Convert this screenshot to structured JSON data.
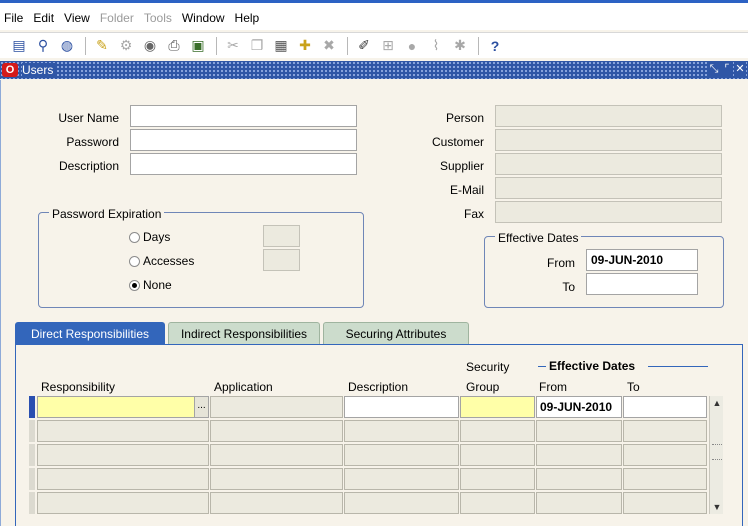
{
  "menu": [
    "File",
    "Edit",
    "View",
    "Folder",
    "Tools",
    "Window",
    "Help"
  ],
  "menu_disabled": [
    "Folder",
    "Tools"
  ],
  "window": {
    "title": "Users"
  },
  "user_form": {
    "user_name_label": "User Name",
    "password_label": "Password",
    "description_label": "Description",
    "person_label": "Person",
    "customer_label": "Customer",
    "supplier_label": "Supplier",
    "email_label": "E-Mail",
    "fax_label": "Fax"
  },
  "password_expiration": {
    "title": "Password Expiration",
    "days_label": "Days",
    "accesses_label": "Accesses",
    "none_label": "None",
    "selected": "None"
  },
  "effective_dates": {
    "title": "Effective Dates",
    "from_label": "From",
    "to_label": "To",
    "from_value": "09-JUN-2010",
    "to_value": ""
  },
  "tabs": [
    "Direct Responsibilities",
    "Indirect Responsibilities",
    "Securing Attributes"
  ],
  "responsibilities": {
    "effective_dates_header": "Effective Dates",
    "columns": {
      "responsibility": "Responsibility",
      "application": "Application",
      "description": "Description",
      "security_group_line1": "Security",
      "security_group_line2": "Group",
      "from": "From",
      "to": "To"
    },
    "rows": [
      {
        "responsibility": "",
        "application": "",
        "description": "",
        "security_group": "",
        "from": "09-JUN-2010",
        "to": ""
      },
      {
        "responsibility": "",
        "application": "",
        "description": "",
        "security_group": "",
        "from": "",
        "to": ""
      },
      {
        "responsibility": "",
        "application": "",
        "description": "",
        "security_group": "",
        "from": "",
        "to": ""
      },
      {
        "responsibility": "",
        "application": "",
        "description": "",
        "security_group": "",
        "from": "",
        "to": ""
      },
      {
        "responsibility": "",
        "application": "",
        "description": "",
        "security_group": "",
        "from": "",
        "to": ""
      }
    ],
    "lov_button": "..."
  },
  "colors": {
    "title_bar": "#2f56a6",
    "active_tab": "#3366bb",
    "inactive_tab": "#ccdccc",
    "required_field": "#ffffa8",
    "form_background": "#f7f3ea"
  },
  "icons": [
    "new-record-icon",
    "find-icon",
    "navigator-icon",
    "save-icon",
    "next-step-icon",
    "switch-responsibility-icon",
    "print-icon",
    "close-form-icon",
    "cut-icon",
    "copy-icon",
    "paste-icon",
    "new-icon",
    "delete-icon",
    "edit-field-icon",
    "zoom-icon",
    "translations-icon",
    "attachments-icon",
    "folder-tools-icon",
    "help-icon"
  ]
}
